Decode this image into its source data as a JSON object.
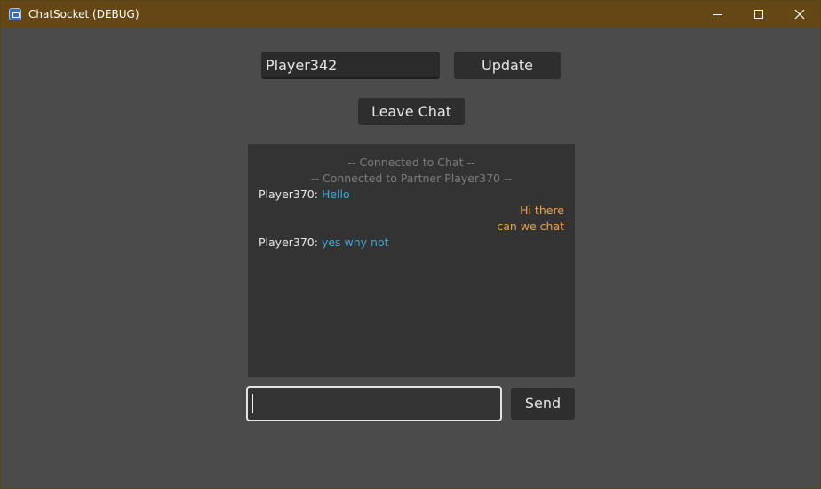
{
  "window": {
    "title": "ChatSocket (DEBUG)",
    "controls": [
      "minimize-icon",
      "maximize-icon",
      "close-icon"
    ]
  },
  "colors": {
    "titlebar": "#654615",
    "background": "#4b4b4b",
    "chat_background": "#333333",
    "system_text": "#7c7c7c",
    "partner_message": "#45a3d6",
    "own_message": "#e8a24d"
  },
  "name_input": {
    "value": "Player342"
  },
  "buttons": {
    "update": "Update",
    "leave": "Leave Chat",
    "send": "Send"
  },
  "chat": {
    "system": [
      "-- Connected to Chat --",
      "-- Connected to Partner Player370 --"
    ],
    "partner_1": {
      "sender": "Player370:",
      "text": "Hello"
    },
    "own": [
      "Hi there",
      "can we chat"
    ],
    "partner_2": {
      "sender": "Player370:",
      "text": "yes why not"
    }
  },
  "message_input": {
    "value": ""
  }
}
